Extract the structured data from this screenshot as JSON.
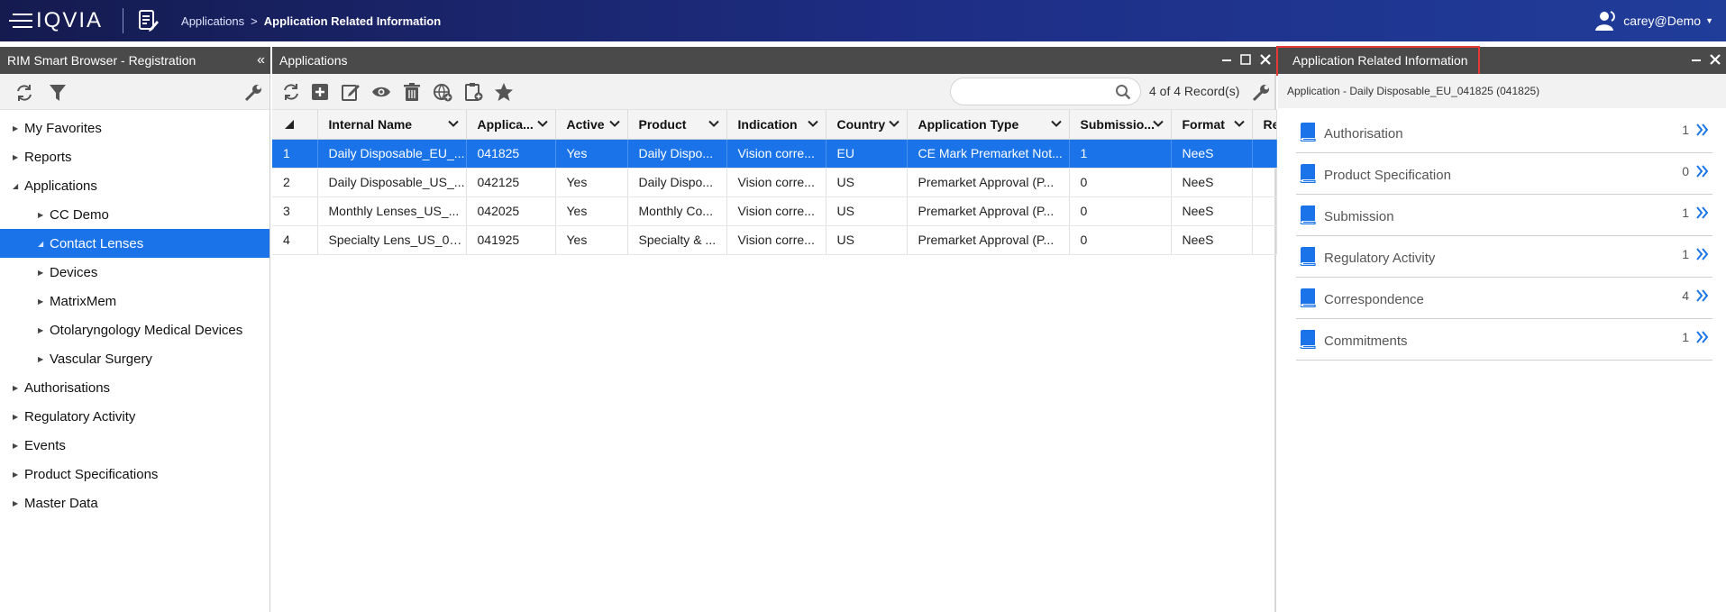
{
  "header": {
    "logo_text": "IQVIA",
    "breadcrumb": {
      "parent": "Applications",
      "separator": ">",
      "current": "Application Related Information"
    },
    "user": "carey@Demo"
  },
  "left_panel": {
    "title": "RIM Smart Browser - Registration",
    "collapse_glyph": "«",
    "tree": [
      {
        "label": "My Favorites",
        "level": 0,
        "expanded": false
      },
      {
        "label": "Reports",
        "level": 0,
        "expanded": false
      },
      {
        "label": "Applications",
        "level": 0,
        "expanded": true
      },
      {
        "label": "CC Demo",
        "level": 1,
        "expanded": false
      },
      {
        "label": "Contact Lenses",
        "level": 1,
        "expanded": true,
        "selected": true
      },
      {
        "label": "Devices",
        "level": 1,
        "expanded": false
      },
      {
        "label": "MatrixMem",
        "level": 1,
        "expanded": false
      },
      {
        "label": "Otolaryngology Medical Devices",
        "level": 1,
        "expanded": false
      },
      {
        "label": "Vascular Surgery",
        "level": 1,
        "expanded": false
      },
      {
        "label": "Authorisations",
        "level": 0,
        "expanded": false
      },
      {
        "label": "Regulatory Activity",
        "level": 0,
        "expanded": false
      },
      {
        "label": "Events",
        "level": 0,
        "expanded": false
      },
      {
        "label": "Product Specifications",
        "level": 0,
        "expanded": false
      },
      {
        "label": "Master Data",
        "level": 0,
        "expanded": false
      }
    ]
  },
  "center_panel": {
    "title": "Applications",
    "record_count": "4 of 4 Record(s)",
    "search": {
      "value": "",
      "placeholder": ""
    },
    "columns": [
      "Internal Name",
      "Applica...",
      "Active",
      "Product",
      "Indication",
      "Country",
      "Application Type",
      "Submissio...",
      "Format",
      "Re"
    ],
    "rows": [
      {
        "num": "1",
        "cells": [
          "Daily Disposable_EU_...",
          "041825",
          "Yes",
          "Daily Dispo...",
          "Vision corre...",
          "EU",
          "CE Mark Premarket Not...",
          "1",
          "NeeS",
          ""
        ],
        "selected": true
      },
      {
        "num": "2",
        "cells": [
          "Daily Disposable_US_...",
          "042125",
          "Yes",
          "Daily Dispo...",
          "Vision corre...",
          "US",
          "Premarket Approval (P...",
          "0",
          "NeeS",
          ""
        ]
      },
      {
        "num": "3",
        "cells": [
          "Monthly Lenses_US_...",
          "042025",
          "Yes",
          "Monthly Co...",
          "Vision corre...",
          "US",
          "Premarket Approval (P...",
          "0",
          "NeeS",
          ""
        ]
      },
      {
        "num": "4",
        "cells": [
          "Specialty Lens_US_04...",
          "041925",
          "Yes",
          "Specialty & ...",
          "Vision corre...",
          "US",
          "Premarket Approval (P...",
          "0",
          "NeeS",
          ""
        ]
      }
    ]
  },
  "right_panel": {
    "title": "Application Related Information",
    "subtitle": "Application - Daily Disposable_EU_041825 (041825)",
    "items": [
      {
        "label": "Authorisation",
        "count": "1"
      },
      {
        "label": "Product Specification",
        "count": "0"
      },
      {
        "label": "Submission",
        "count": "1"
      },
      {
        "label": "Regulatory Activity",
        "count": "1"
      },
      {
        "label": "Correspondence",
        "count": "4"
      },
      {
        "label": "Commitments",
        "count": "1"
      }
    ]
  },
  "colors": {
    "header": "#1e2e86",
    "titlebar": "#4a4a4a",
    "selection": "#1a73e8",
    "icon_blue": "#1a73e8",
    "highlight": "#e53935"
  }
}
